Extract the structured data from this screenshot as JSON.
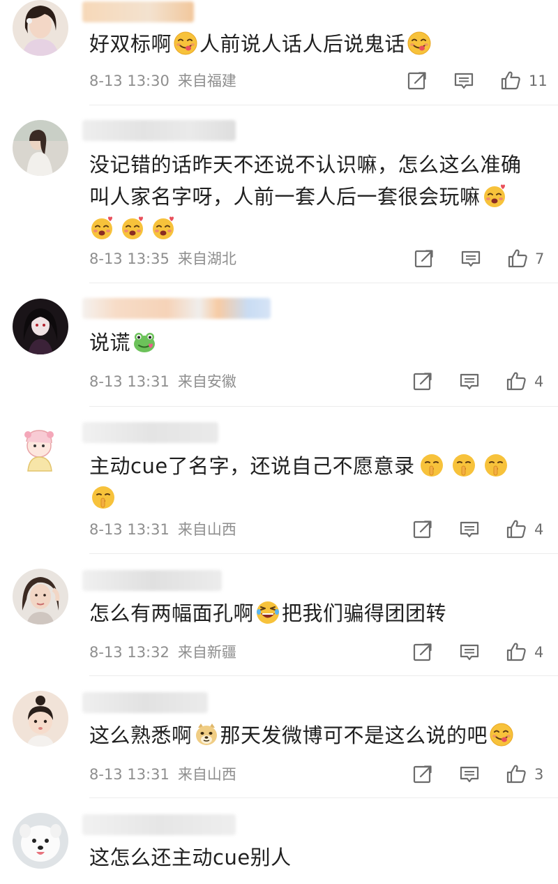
{
  "comments": [
    {
      "avatar": "avatar-girl-pink",
      "text_parts": [
        "好双标啊",
        "人前说人话人后说鬼话"
      ],
      "date": "8-13 13:30",
      "location": "来自福建",
      "likes": "11"
    },
    {
      "avatar": "avatar-girl-outdoor",
      "text_lines": [
        "没记错的话昨天不还说不认识嘛，怎么这么准确",
        "叫人家名字呀，人前一套人后一套很会玩嘛"
      ],
      "date": "8-13 13:35",
      "location": "来自湖北",
      "likes": "7"
    },
    {
      "avatar": "avatar-anime-dark",
      "text": "说谎",
      "date": "8-13 13:31",
      "location": "来自安徽",
      "likes": "4"
    },
    {
      "avatar": "avatar-cartoon-girl",
      "text": "主动cue了名字，还说自己不愿意录",
      "date": "8-13 13:31",
      "location": "来自山西",
      "likes": "4"
    },
    {
      "avatar": "avatar-woman-pose",
      "text_parts": [
        "怎么有两幅面孔啊",
        "把我们骗得团团转"
      ],
      "date": "8-13 13:32",
      "location": "来自新疆",
      "likes": "4"
    },
    {
      "avatar": "avatar-baby",
      "text_parts": [
        "这么熟悉啊",
        "那天发微博可不是这么说的吧"
      ],
      "date": "8-13 13:31",
      "location": "来自山西",
      "likes": "3"
    },
    {
      "avatar": "avatar-dog",
      "text": "这怎么还主动cue别人"
    }
  ],
  "icons": {
    "share": "share-icon",
    "comment": "comment-icon",
    "like": "like-icon",
    "emoji_yum": "yum-emoji-icon",
    "emoji_love": "smiling-hearts-emoji-icon",
    "emoji_frog": "frog-emoji-icon",
    "emoji_shush": "shush-emoji-icon",
    "emoji_laugh": "laughing-emoji-icon",
    "emoji_doge": "doge-emoji-icon"
  },
  "colors": {
    "meta_text": "#8e8e8e",
    "body_text": "#1f1f1f",
    "divider": "#ececec",
    "icon_stroke": "#6b6b6b"
  }
}
